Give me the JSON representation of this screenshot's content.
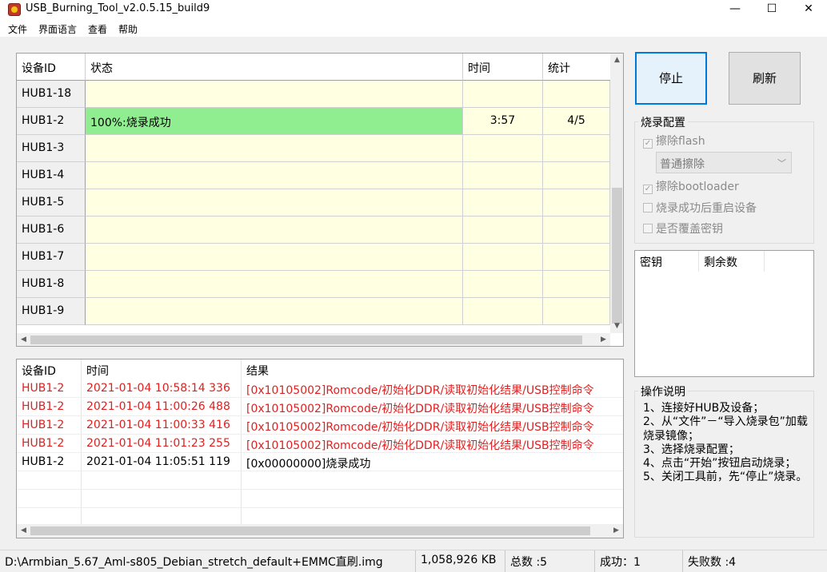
{
  "window": {
    "title": "USB_Burning_Tool_v2.0.5.15_build9",
    "minimize": "—",
    "maximize": "☐",
    "close": "✕"
  },
  "menu": [
    "文件",
    "界面语言",
    "查看",
    "帮助"
  ],
  "device_grid": {
    "headers": [
      "设备ID",
      "状态",
      "时间",
      "统计"
    ],
    "rows": [
      {
        "id": "HUB1-18",
        "status": "",
        "time": "",
        "stat": ""
      },
      {
        "id": "HUB1-2",
        "status": "100%:烧录成功",
        "time": "3:57",
        "stat": "4/5"
      },
      {
        "id": "HUB1-3",
        "status": "",
        "time": "",
        "stat": ""
      },
      {
        "id": "HUB1-4",
        "status": "",
        "time": "",
        "stat": ""
      },
      {
        "id": "HUB1-5",
        "status": "",
        "time": "",
        "stat": ""
      },
      {
        "id": "HUB1-6",
        "status": "",
        "time": "",
        "stat": ""
      },
      {
        "id": "HUB1-7",
        "status": "",
        "time": "",
        "stat": ""
      },
      {
        "id": "HUB1-8",
        "status": "",
        "time": "",
        "stat": ""
      },
      {
        "id": "HUB1-9",
        "status": "",
        "time": "",
        "stat": ""
      }
    ]
  },
  "log": {
    "headers": [
      "设备ID",
      "时间",
      "结果"
    ],
    "rows": [
      {
        "id": "HUB1-2",
        "time": "2021-01-04 10:58:14 336",
        "result": "[0x10105002]Romcode/初始化DDR/读取初始化结果/USB控制命令",
        "error": true
      },
      {
        "id": "HUB1-2",
        "time": "2021-01-04 11:00:26 488",
        "result": "[0x10105002]Romcode/初始化DDR/读取初始化结果/USB控制命令",
        "error": true
      },
      {
        "id": "HUB1-2",
        "time": "2021-01-04 11:00:33 416",
        "result": "[0x10105002]Romcode/初始化DDR/读取初始化结果/USB控制命令",
        "error": true
      },
      {
        "id": "HUB1-2",
        "time": "2021-01-04 11:01:23 255",
        "result": "[0x10105002]Romcode/初始化DDR/读取初始化结果/USB控制命令",
        "error": true
      },
      {
        "id": "HUB1-2",
        "time": "2021-01-04 11:05:51 119",
        "result": "[0x00000000]烧录成功",
        "error": false
      }
    ]
  },
  "buttons": {
    "stop": "停止",
    "refresh": "刷新"
  },
  "burn_config": {
    "title": "烧录配置",
    "erase_flash": {
      "label": "擦除flash",
      "checked": true
    },
    "erase_mode": "普通擦除",
    "erase_bootloader": {
      "label": "擦除bootloader",
      "checked": true
    },
    "reboot_after": {
      "label": "烧录成功后重启设备",
      "checked": false
    },
    "overwrite_key": {
      "label": "是否覆盖密钥",
      "checked": false
    }
  },
  "key_list": {
    "headers": [
      "密钥",
      "剩余数"
    ]
  },
  "instructions": {
    "title": "操作说明",
    "lines": [
      "1、连接好HUB及设备；",
      "2、从“文件”－“导入烧录包”加载烧录镜像；",
      "3、选择烧录配置；",
      "4、点击“开始”按钮启动烧录；",
      "5、关闭工具前，先“停止”烧录。"
    ]
  },
  "status_bar": {
    "path": "D:\\Armbian_5.67_Aml-s805_Debian_stretch_default+EMMC直刷.img",
    "size": "1,058,926 KB",
    "total": "总数 :5",
    "success": "成功：1",
    "fail": "失败数 :4"
  },
  "colors": {
    "success_row": "#90ee90",
    "grid_bg": "#ffffe1",
    "error_text": "#e02020",
    "focus": "#0078d7"
  }
}
